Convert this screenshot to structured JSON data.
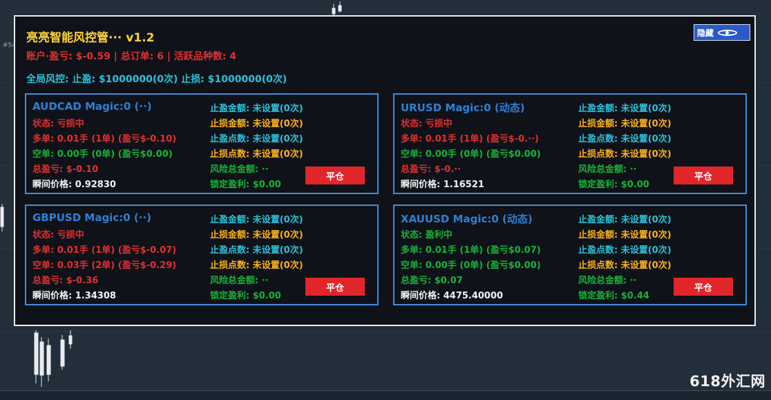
{
  "ea": {
    "title": "亮亮智能风控管··· v1.2",
    "account_line": "账户·盈亏: $-0.59 | 总订单: 6 | 活跃品种数: 4",
    "global_risk_line": "全局风控: 止盈: $1000000(0次) 止损: $1000000(0次)",
    "hide_button_label": "隐藏"
  },
  "cards": [
    {
      "header": "AUDCAD Magic:0 (··)",
      "status": "状态: 亏损中",
      "long": "多单: 0.01手 (1单) (盈亏$-0.10)",
      "short": "空单: 0.00手 (0单) (盈亏$0.00)",
      "total": "总盈亏: $-0.10",
      "price": "瞬间价格: 0.92830",
      "tp_amount": "止盈金额: 未设置(0次)",
      "sl_amount": "止损金额: 未设置(0次)",
      "tp_points": "止盈点数: 未设置(0次)",
      "sl_points": "止损点数: 未设置(0次)",
      "risk_total": "风险总金额: ··",
      "lock_profit": "锁定盈利: $0.00",
      "close_label": "平仓"
    },
    {
      "header": "URUSD Magic:0 (动态)",
      "status": "状态: 亏损中",
      "long": "多单: 0.01手 (1单) (盈亏$-0.··)",
      "short": "空单: 0.00手 (0单) (盈亏$0.00)",
      "total": "总盈亏: $-0.··",
      "price": "瞬间价格: 1.16521",
      "tp_amount": "止盈金额: 未设置(0次)",
      "sl_amount": "止损金额: 未设置(0次)",
      "tp_points": "止盈点数: 未设置(0次)",
      "sl_points": "止损点数: 未设置(0次)",
      "risk_total": "风险总金额: ··",
      "lock_profit": "锁定盈利: $0.00",
      "close_label": "平仓"
    },
    {
      "header": "GBPUSD Magic:0 (··)",
      "status": "状态: 亏损中",
      "long": "多单: 0.01手 (1单) (盈亏$-0.07)",
      "short": "空单: 0.03手 (2单) (盈亏$-0.29)",
      "total": "总盈亏: $-0.36",
      "price": "瞬间价格: 1.34308",
      "tp_amount": "止盈金额: 未设置(0次)",
      "sl_amount": "止损金额: 未设置(0次)",
      "tp_points": "止盈点数: 未设置(0次)",
      "sl_points": "止损点数: 未设置(0次)",
      "risk_total": "风险总金额: ··",
      "lock_profit": "锁定盈利: $0.00",
      "close_label": "平仓"
    },
    {
      "header": "XAUUSD Magic:0 (动态)",
      "status": "状态: 盈利中",
      "long": "多单: 0.01手 (1单) (盈亏$0.07)",
      "short": "空单: 0.00手 (0单) (盈亏$0.00)",
      "total": "总盈亏: $0.07",
      "price": "瞬间价格: 4475.40000",
      "tp_amount": "止盈金额: 未设置(0次)",
      "sl_amount": "止损金额: 未设置(0次)",
      "tp_points": "止盈点数: 未设置(0次)",
      "sl_points": "止损点数: 未设置(0次)",
      "risk_total": "风险总金额: ··",
      "lock_profit": "锁定盈利: $0.44",
      "close_label": "平仓"
    }
  ],
  "watermark": "618外汇网",
  "edge_label": "#54",
  "colors": {
    "background": "#222e3a",
    "panel": "#0f1218",
    "card_border": "#3e8fe0",
    "title": "#ffd23a",
    "loss": "#e23030",
    "profit": "#17b33a",
    "accent_cyan": "#29c3dc",
    "close_button": "#e0262b",
    "hide_button": "#2a5ac8"
  }
}
